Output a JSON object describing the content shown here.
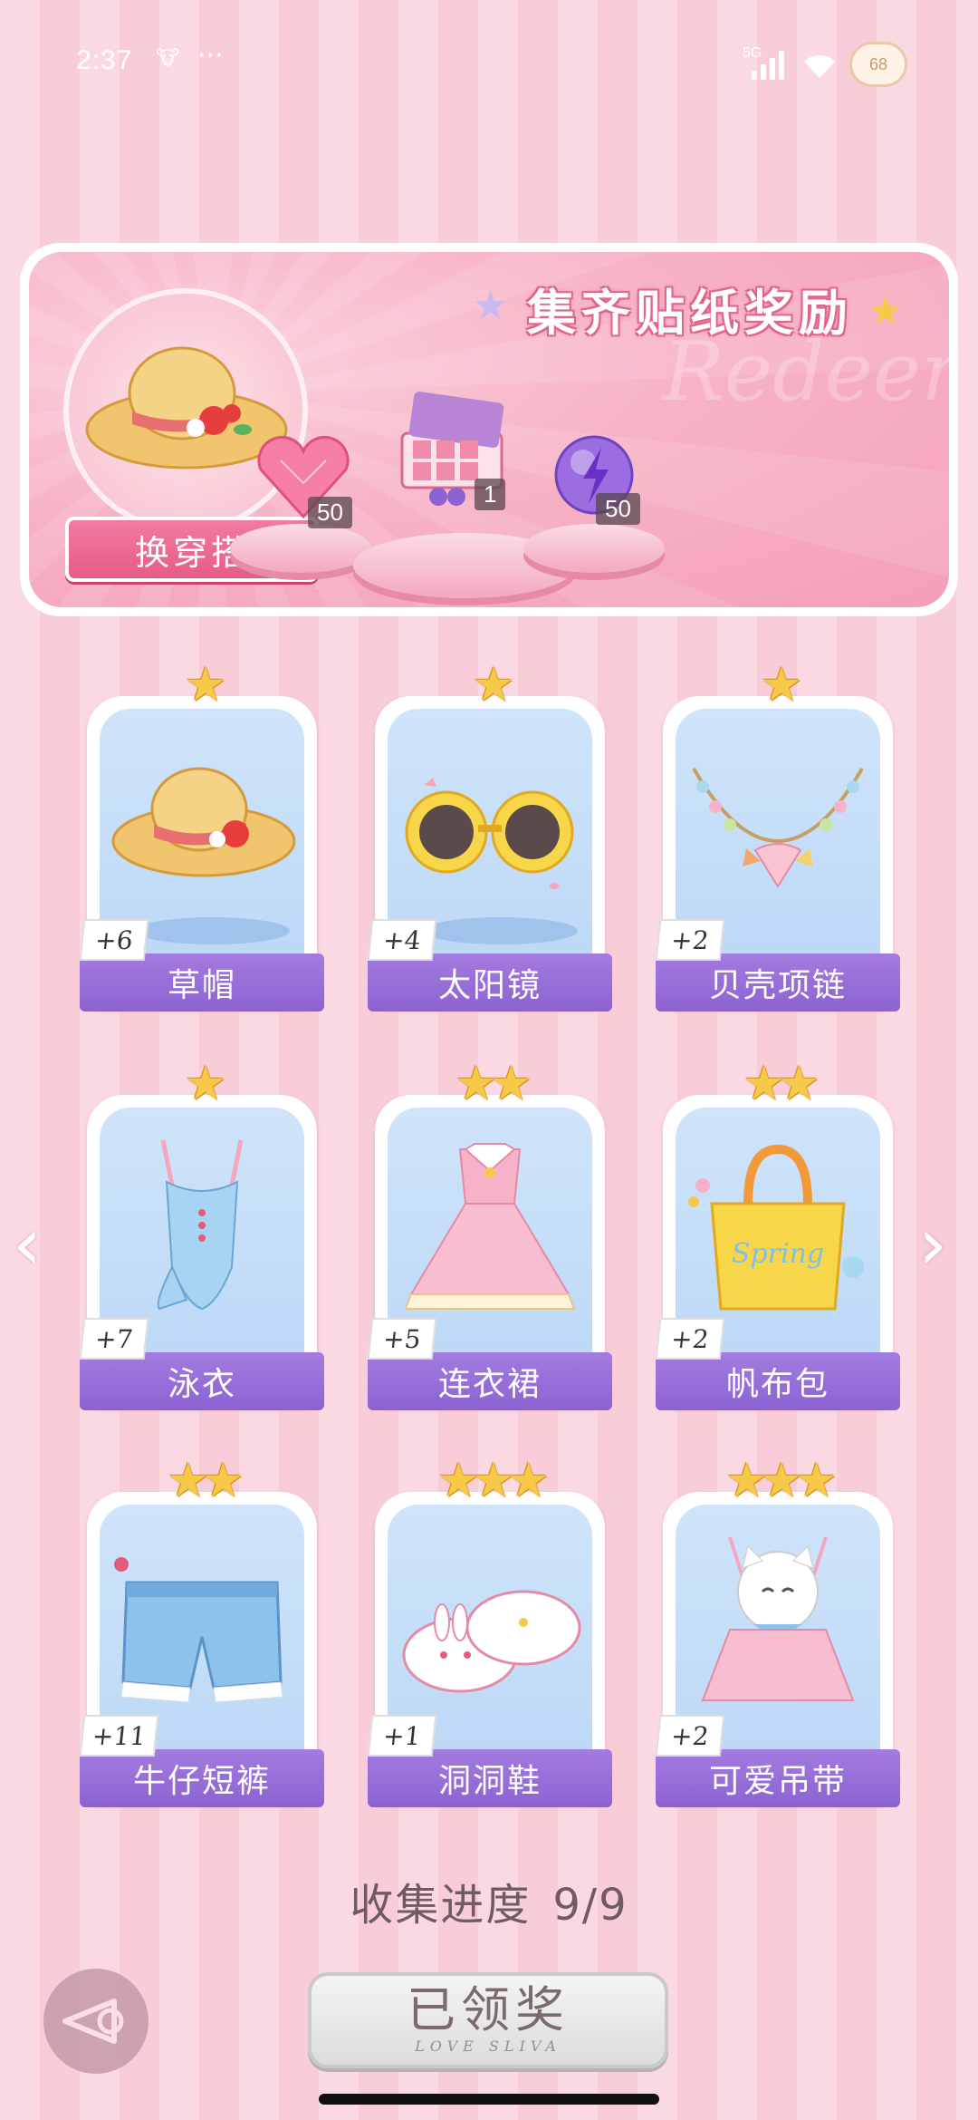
{
  "status_bar": {
    "time": "2:37",
    "network": "5G",
    "battery": "68"
  },
  "banner": {
    "title": "集齐贴纸奖励",
    "watermark": "Redeem",
    "outfit_button": "换穿搭",
    "rewards": [
      {
        "icon": "pink-heart-gem-icon",
        "count": "50"
      },
      {
        "icon": "gift-box-icon",
        "count": "1"
      },
      {
        "icon": "purple-energy-orb-icon",
        "count": "50"
      }
    ]
  },
  "items": [
    {
      "name": "草帽",
      "count": "+6",
      "stars": 1,
      "icon": "straw-hat-icon"
    },
    {
      "name": "太阳镜",
      "count": "+4",
      "stars": 1,
      "icon": "sunglasses-icon"
    },
    {
      "name": "贝壳项链",
      "count": "+2",
      "stars": 1,
      "icon": "shell-necklace-icon"
    },
    {
      "name": "泳衣",
      "count": "+7",
      "stars": 1,
      "icon": "swimsuit-icon"
    },
    {
      "name": "连衣裙",
      "count": "+5",
      "stars": 2,
      "icon": "dress-icon"
    },
    {
      "name": "帆布包",
      "count": "+2",
      "stars": 2,
      "icon": "canvas-bag-icon"
    },
    {
      "name": "牛仔短裤",
      "count": "+11",
      "stars": 2,
      "icon": "denim-shorts-icon"
    },
    {
      "name": "洞洞鞋",
      "count": "+1",
      "stars": 3,
      "icon": "clog-shoes-icon"
    },
    {
      "name": "可爱吊带",
      "count": "+2",
      "stars": 3,
      "icon": "cute-camisole-icon"
    }
  ],
  "progress": {
    "label": "收集进度",
    "value": "9/9"
  },
  "claim_button": {
    "label": "已领奖",
    "sub": "LOVE SLIVA"
  }
}
